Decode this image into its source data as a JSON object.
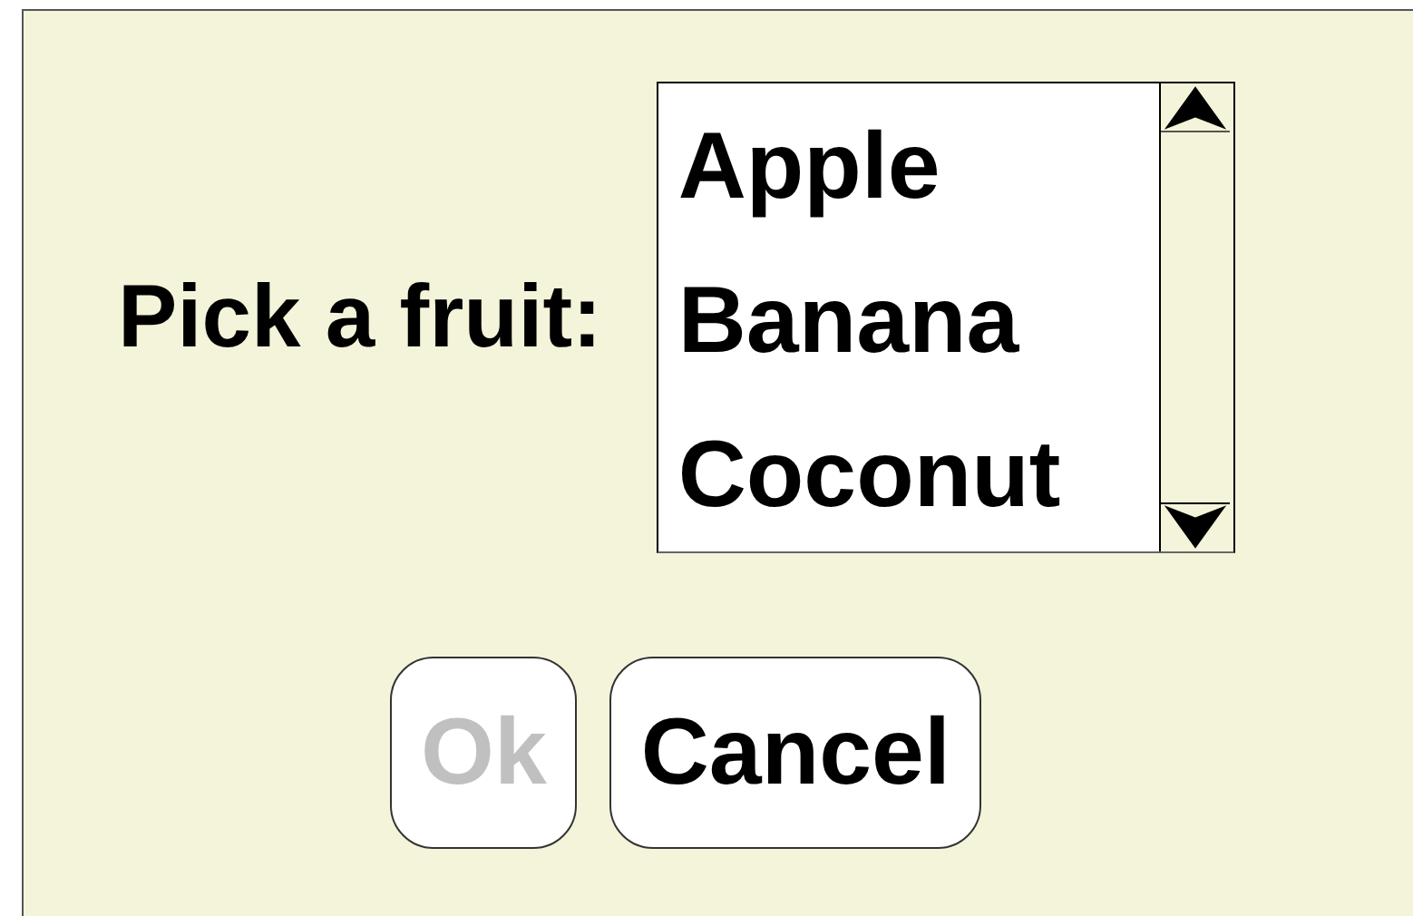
{
  "prompt": "Pick a fruit:",
  "list": {
    "items": [
      {
        "label": "Apple"
      },
      {
        "label": "Banana"
      },
      {
        "label": "Coconut"
      }
    ]
  },
  "buttons": [
    {
      "label": "Ok",
      "disabled": true
    },
    {
      "label": "Cancel",
      "disabled": false
    }
  ]
}
